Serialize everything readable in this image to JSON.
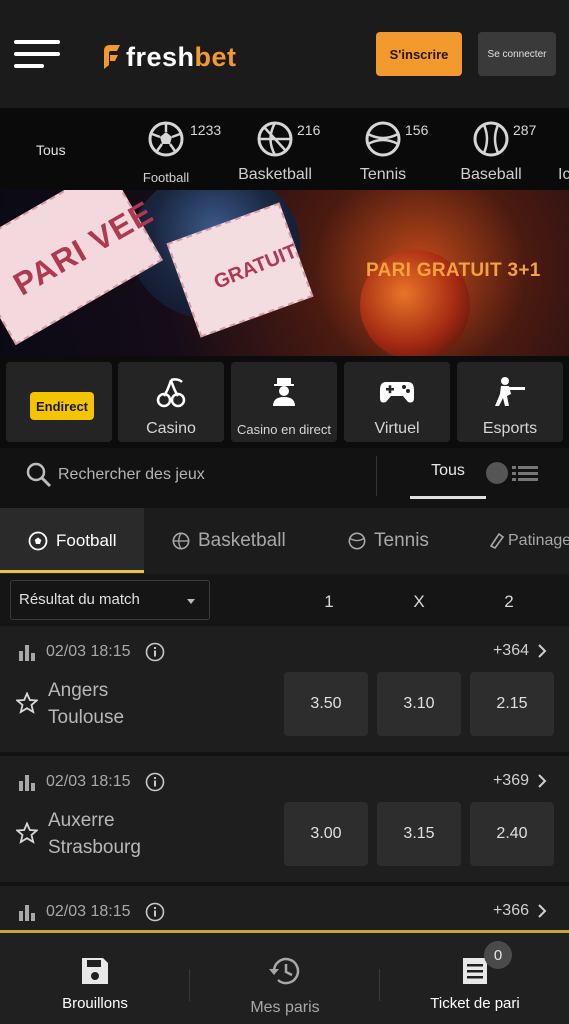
{
  "header": {
    "logo_text_1": "fresh",
    "logo_text_2": "bet",
    "register_label": "S'inscrire",
    "login_label": "Se connecter"
  },
  "sports_strip": {
    "all_label": "Tous",
    "items": [
      {
        "label": "Football",
        "count": "1233",
        "icon": "football-icon"
      },
      {
        "label": "Basketball",
        "count": "216",
        "icon": "basketball-icon"
      },
      {
        "label": "Tennis",
        "count": "156",
        "icon": "tennis-icon"
      },
      {
        "label": "Baseball",
        "count": "287",
        "icon": "baseball-icon"
      },
      {
        "label": "Ic",
        "count": "",
        "icon": ""
      }
    ]
  },
  "banner": {
    "ticket_left": "PARI VEE",
    "ticket_right": "GRATUIT",
    "promo_text": "PARI GRATUIT 3+1"
  },
  "categories": [
    {
      "label": "Endirect",
      "icon": ""
    },
    {
      "label": "Casino",
      "icon": "cherries-icon"
    },
    {
      "label": "Casino en direct",
      "icon": "dealer-icon"
    },
    {
      "label": "Virtuel",
      "icon": "gamepad-icon"
    },
    {
      "label": "Esports",
      "icon": "soldier-icon"
    }
  ],
  "search": {
    "placeholder": "Rechercher des jeux",
    "filter_tab": "Tous"
  },
  "sport_tabs": [
    {
      "label": "Football",
      "active": true
    },
    {
      "label": "Basketball",
      "active": false
    },
    {
      "label": "Tennis",
      "active": false
    },
    {
      "label": "Patinage",
      "active": false
    }
  ],
  "market": {
    "selected": "Résultat du match",
    "columns": [
      "1",
      "X",
      "2"
    ]
  },
  "matches": [
    {
      "datetime": "02/03 18:15",
      "home": "Angers",
      "away": "Toulouse",
      "odds": [
        "3.50",
        "3.10",
        "2.15"
      ],
      "more": "+364"
    },
    {
      "datetime": "02/03 18:15",
      "home": "Auxerre",
      "away": "Strasbourg",
      "odds": [
        "3.00",
        "3.15",
        "2.40"
      ],
      "more": "+369"
    },
    {
      "datetime": "02/03 18:15",
      "home": "",
      "away": "",
      "odds": [],
      "more": "+366"
    }
  ],
  "bottom_nav": {
    "drafts": "Brouillons",
    "my_bets": "Mes paris",
    "ticket": "Ticket de pari",
    "ticket_count": "0"
  },
  "colors": {
    "accent_orange": "#f39a2e",
    "live_yellow": "#f5c400",
    "tab_underline": "#e8c24a"
  }
}
